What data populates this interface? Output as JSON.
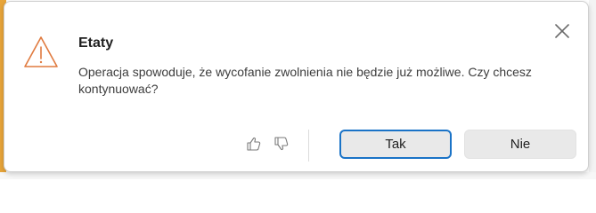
{
  "dialog": {
    "title": "Etaty",
    "message": "Operacja spowoduje, że wycofanie zwolnienia nie będzie już możliwe. Czy chcesz kontynuować?",
    "yes_label": "Tak",
    "no_label": "Nie"
  },
  "icons": {
    "warning": "warning-triangle-icon",
    "close": "close-icon",
    "thumbs_up": "thumbs-up-icon",
    "thumbs_down": "thumbs-down-icon"
  },
  "colors": {
    "warning": "#e07a3f",
    "primary_border": "#1a73c7",
    "button_bg": "#e9e9e9",
    "side_accent": "#e8a53a"
  }
}
